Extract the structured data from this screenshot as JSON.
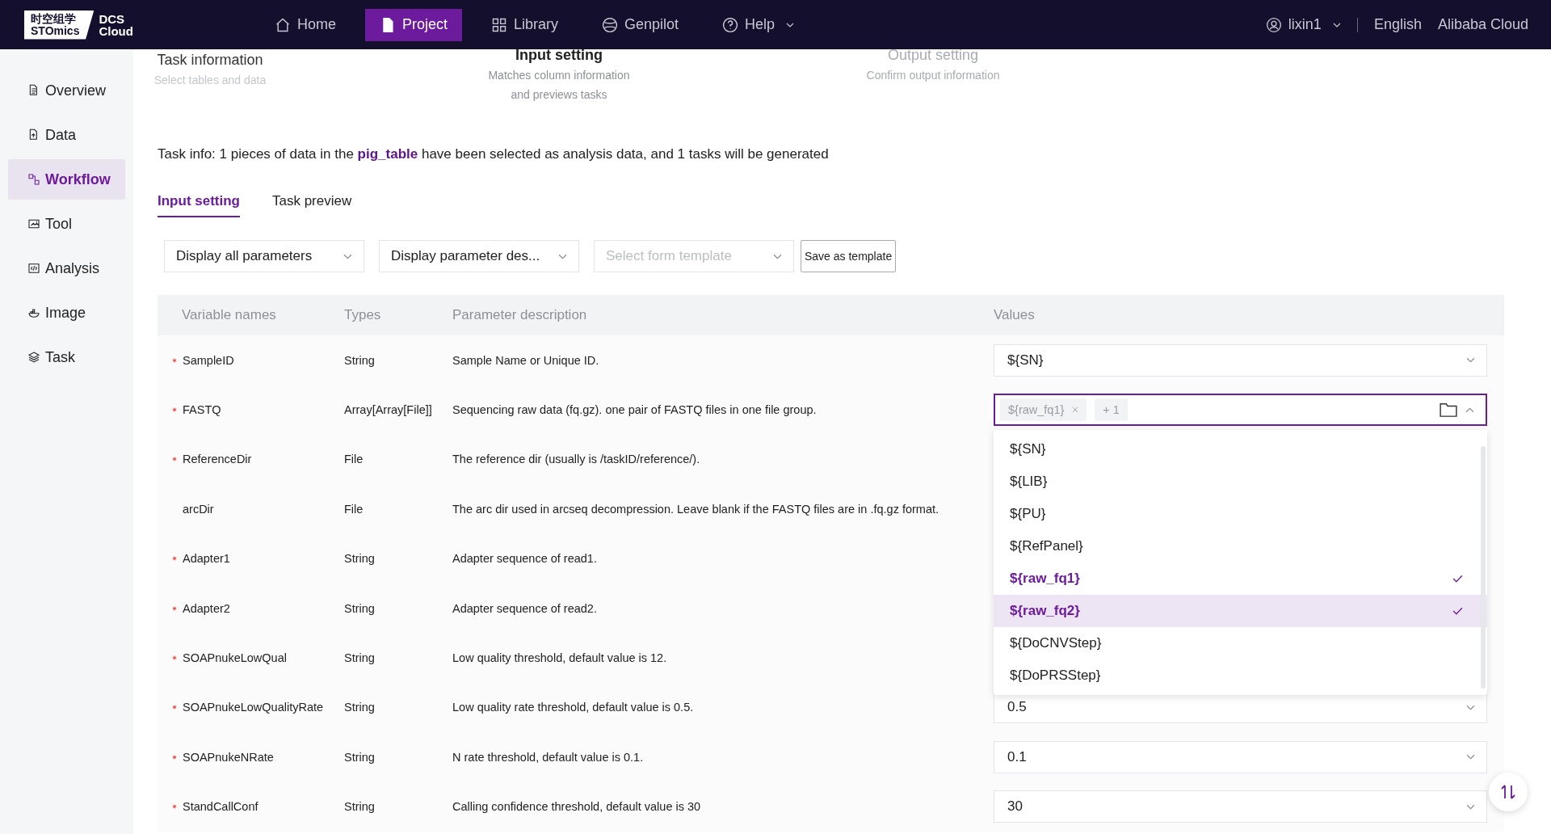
{
  "logo": {
    "cn": "时空组学",
    "en": "STOmics",
    "product_line1": "DCS",
    "product_line2": "Cloud"
  },
  "nav": [
    {
      "label": "Home",
      "selected": false
    },
    {
      "label": "Project",
      "selected": true
    },
    {
      "label": "Library",
      "selected": false
    },
    {
      "label": "Genpilot",
      "selected": false
    },
    {
      "label": "Help",
      "selected": false
    }
  ],
  "user": {
    "name": "lixin1"
  },
  "language": "English",
  "cloud": "Alibaba Cloud",
  "sidebar": {
    "items": [
      {
        "label": "Overview",
        "selected": false
      },
      {
        "label": "Data",
        "selected": false
      },
      {
        "label": "Workflow",
        "selected": true
      },
      {
        "label": "Tool",
        "selected": false
      },
      {
        "label": "Analysis",
        "selected": false
      },
      {
        "label": "Image",
        "selected": false
      },
      {
        "label": "Task",
        "selected": false
      }
    ]
  },
  "steps": [
    {
      "title": "Task information",
      "subtitle": "Select tables and data",
      "completed": true,
      "selected": false
    },
    {
      "title": "Input setting",
      "subtitle": "Matches column information and previews tasks",
      "completed": false,
      "selected": true
    },
    {
      "title": "Output setting",
      "subtitle": "Confirm output information",
      "completed": false,
      "selected": false
    }
  ],
  "task_info": "Task info: 1 pieces of data in the **pig_table** have been selected as analysis data, and 1 tasks will be generated",
  "tabs": [
    {
      "label": "Input setting",
      "selected": true
    },
    {
      "label": "Task preview",
      "selected": false
    }
  ],
  "filters": [
    {
      "kind": "select",
      "value": "Display all parameters"
    },
    {
      "kind": "select",
      "value": "Display parameter des..."
    },
    {
      "kind": "select",
      "placeholder": "Select form template"
    },
    {
      "kind": "button",
      "label": "Save as template"
    }
  ],
  "table": {
    "columns": [
      "Variable names",
      "Types",
      "Parameter description",
      "Values"
    ],
    "rows": [
      {
        "name": "SampleID",
        "required": true,
        "type": "String",
        "description": "Sample Name or Unique ID.",
        "value": {
          "kind": "select",
          "text": "${SN}",
          "focused": false
        }
      },
      {
        "name": "FASTQ",
        "required": true,
        "type": "Array[Array[File]]",
        "description": "Sequencing raw data (fq.gz). one pair of FASTQ files in one file group.",
        "value": {
          "kind": "tags",
          "tags": [
            "${raw_fq1}"
          ],
          "more": "+ 1",
          "focused": true
        }
      },
      {
        "name": "ReferenceDir",
        "required": true,
        "type": "File",
        "description": "The reference dir (usually is /taskID/reference/)."
      },
      {
        "name": "arcDir",
        "required": false,
        "type": "File",
        "description": "The arc dir used in arcseq decompression. Leave blank if the FASTQ files are in .fq.gz format."
      },
      {
        "name": "Adapter1",
        "required": true,
        "type": "String",
        "description": "Adapter sequence of read1."
      },
      {
        "name": "Adapter2",
        "required": true,
        "type": "String",
        "description": "Adapter sequence of read2."
      },
      {
        "name": "SOAPnukeLowQual",
        "required": true,
        "type": "String",
        "description": "Low quality threshold, default value is 12."
      },
      {
        "name": "SOAPnukeLowQualityRate",
        "required": true,
        "type": "String",
        "description": "Low quality rate threshold, default value is 0.5.",
        "value": {
          "kind": "select",
          "text": "0.5",
          "focused": false
        }
      },
      {
        "name": "SOAPnukeNRate",
        "required": true,
        "type": "String",
        "description": "N rate threshold, default value is 0.1.",
        "value": {
          "kind": "select",
          "text": "0.1",
          "focused": false
        }
      },
      {
        "name": "StandCallConf",
        "required": true,
        "type": "String",
        "description": "Calling confidence threshold, default value is 30",
        "value": {
          "kind": "select",
          "text": "30",
          "focused": false
        }
      }
    ]
  },
  "dropdown": {
    "options": [
      {
        "label": "${SN}",
        "selected": false,
        "hovered": false
      },
      {
        "label": "${LIB}",
        "selected": false,
        "hovered": false
      },
      {
        "label": "${PU}",
        "selected": false,
        "hovered": false
      },
      {
        "label": "${RefPanel}",
        "selected": false,
        "hovered": false
      },
      {
        "label": "${raw_fq1}",
        "selected": true,
        "hovered": false
      },
      {
        "label": "${raw_fq2}",
        "selected": true,
        "hovered": true
      },
      {
        "label": "${DoCNVStep}",
        "selected": false,
        "hovered": false
      },
      {
        "label": "${DoPRSStep}",
        "selected": false,
        "hovered": false
      }
    ]
  }
}
